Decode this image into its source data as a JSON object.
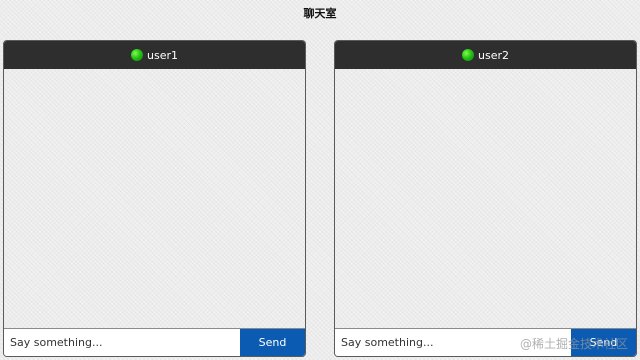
{
  "page": {
    "title": "聊天室"
  },
  "chats": [
    {
      "user_name": "user1",
      "status_color": "#27c316",
      "input_placeholder": "Say something...",
      "send_label": "Send"
    },
    {
      "user_name": "user2",
      "status_color": "#27c316",
      "input_placeholder": "Say something...",
      "send_label": "Send"
    }
  ],
  "watermark": "@稀土掘金技术社区",
  "colors": {
    "header_bg": "#2e2e2e",
    "send_button_bg": "#0b5bb3",
    "online_status": "#27c316"
  }
}
